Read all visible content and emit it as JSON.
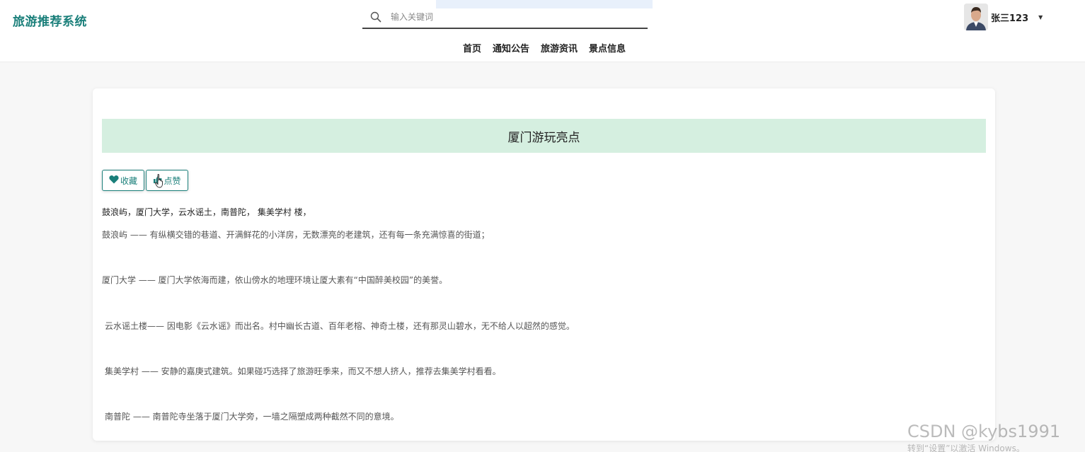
{
  "header": {
    "brand": "旅游推荐系统",
    "search": {
      "placeholder": "输入关键词",
      "value": ""
    },
    "nav": [
      "首页",
      "通知公告",
      "旅游资讯",
      "景点信息"
    ],
    "user": {
      "name": "张三123"
    }
  },
  "article": {
    "title": "厦门游玩亮点",
    "favorite_label": "收藏",
    "like_label": "点赞",
    "summary": "鼓浪屿，厦门大学，云水谣土，南普陀， 集美学村 楼，",
    "paragraphs": [
      "鼓浪屿 —— 有纵横交错的巷道、开满鲜花的小洋房，无数漂亮的老建筑，还有每一条充满惊喜的街道；",
      "厦门大学 —— 厦门大学依海而建，依山傍水的地理环境让厦大素有“中国醉美校园”的美誉。",
      "云水谣土楼—— 因电影《云水谣》而出名。村中幽长古道、百年老榕、神奇土楼，还有那灵山碧水，无不给人以超然的感觉。",
      "集美学村 —— 安静的嘉庚式建筑。如果碰巧选择了旅游旺季来，而又不想人挤人，推荐去集美学村看看。",
      "南普陀 —— 南普陀寺坐落于厦门大学旁，一墙之隔塑成两种截然不同的意境。"
    ]
  },
  "overlay": {
    "watermark": "CSDN @kybs1991",
    "activation": "转到“设置”以激活 Windows。"
  },
  "colors": {
    "brand": "#1a7f7a",
    "title_bg": "#d5efe0",
    "page_bg": "#f7f7f7"
  },
  "icons": {
    "search": "search-icon",
    "favorite": "heart-icon",
    "like": "thumbs-up-icon",
    "dropdown": "caret-down-icon"
  }
}
